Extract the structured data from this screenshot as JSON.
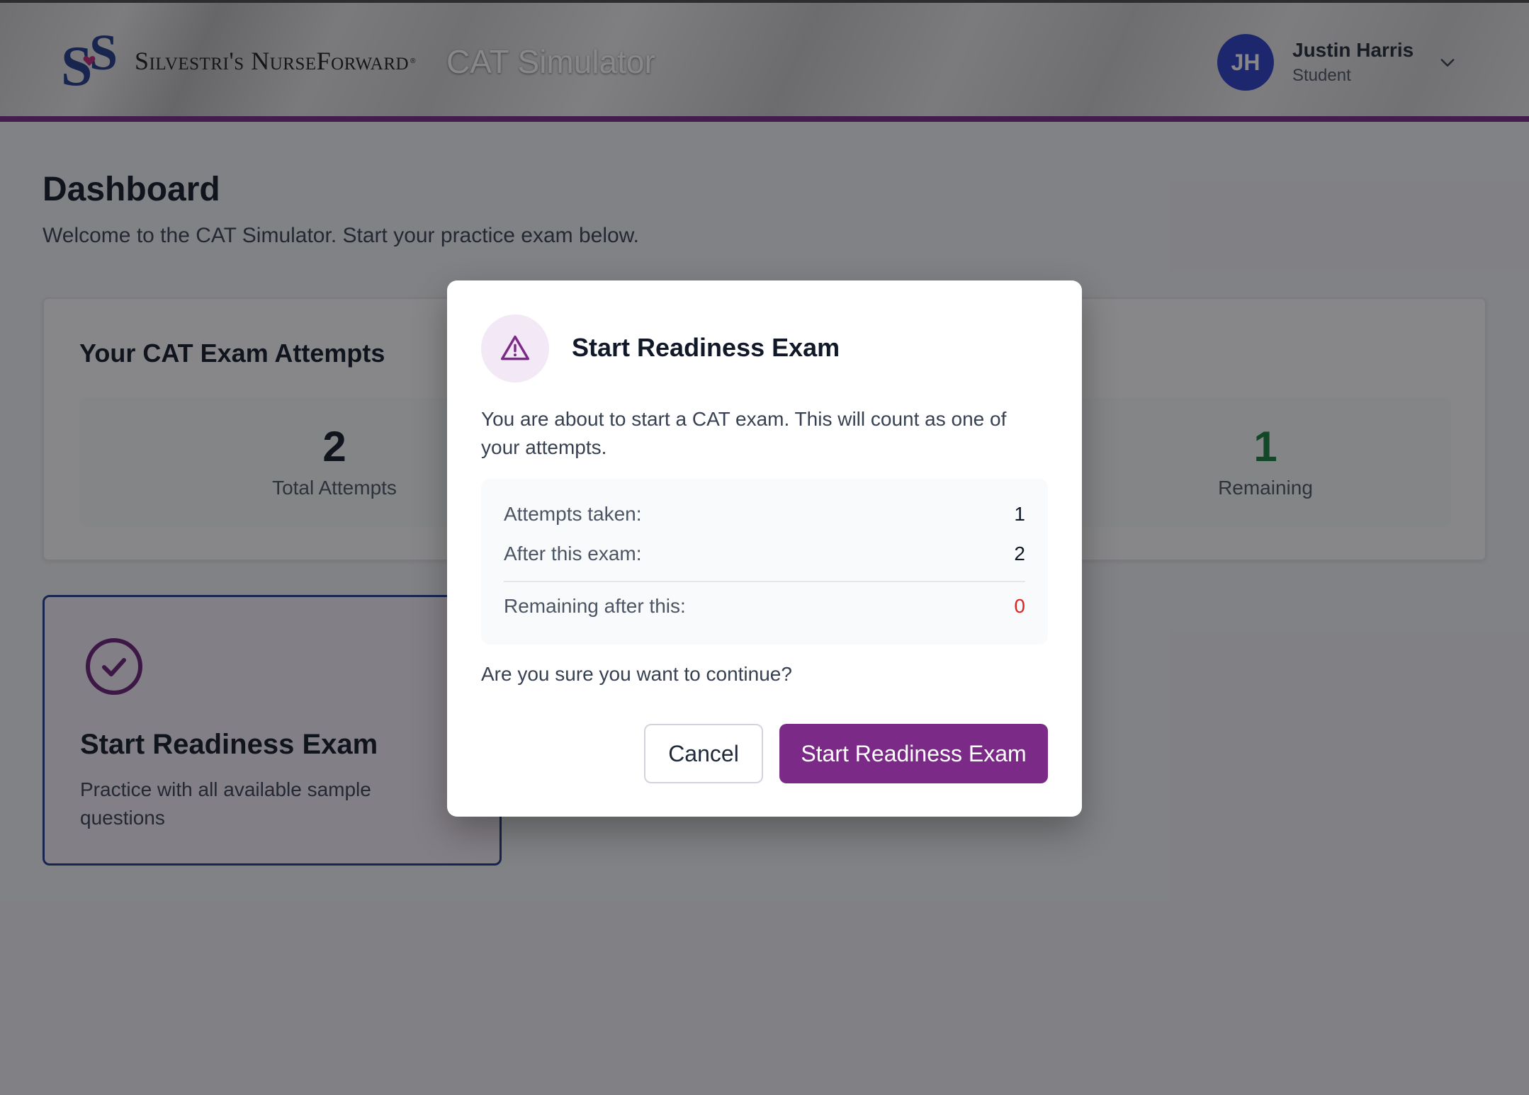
{
  "header": {
    "logo_text": "Silvestri's NurseForward",
    "logo_reg": "®",
    "app_title": "CAT Simulator",
    "user": {
      "initials": "JH",
      "name": "Justin Harris",
      "role": "Student"
    }
  },
  "main": {
    "title": "Dashboard",
    "subtitle": "Welcome to the CAT Simulator. Start your practice exam below.",
    "attempts_card": {
      "title": "Your CAT Exam Attempts",
      "total": {
        "value": "2",
        "label": "Total Attempts"
      },
      "remaining": {
        "value": "1",
        "label": "Remaining"
      }
    },
    "exam_card": {
      "title": "Start Readiness Exam",
      "description": "Practice with all available sample questions"
    }
  },
  "modal": {
    "title": "Start Readiness Exam",
    "body": "You are about to start a CAT exam. This will count as one of your attempts.",
    "summary": [
      {
        "label": "Attempts taken:",
        "value": "1"
      },
      {
        "label": "After this exam:",
        "value": "2"
      },
      {
        "label": "Remaining after this:",
        "value": "0"
      }
    ],
    "question": "Are you sure you want to continue?",
    "cancel_label": "Cancel",
    "confirm_label": "Start Readiness Exam"
  },
  "colors": {
    "brand": "#7b2a87",
    "avatar": "#2a3fc8",
    "remaining_green": "#15803d",
    "warning_red": "#dc2626"
  },
  "icons": {
    "modal": "warning-triangle-icon",
    "exam": "check-circle-icon",
    "user_menu": "chevron-down-icon"
  }
}
